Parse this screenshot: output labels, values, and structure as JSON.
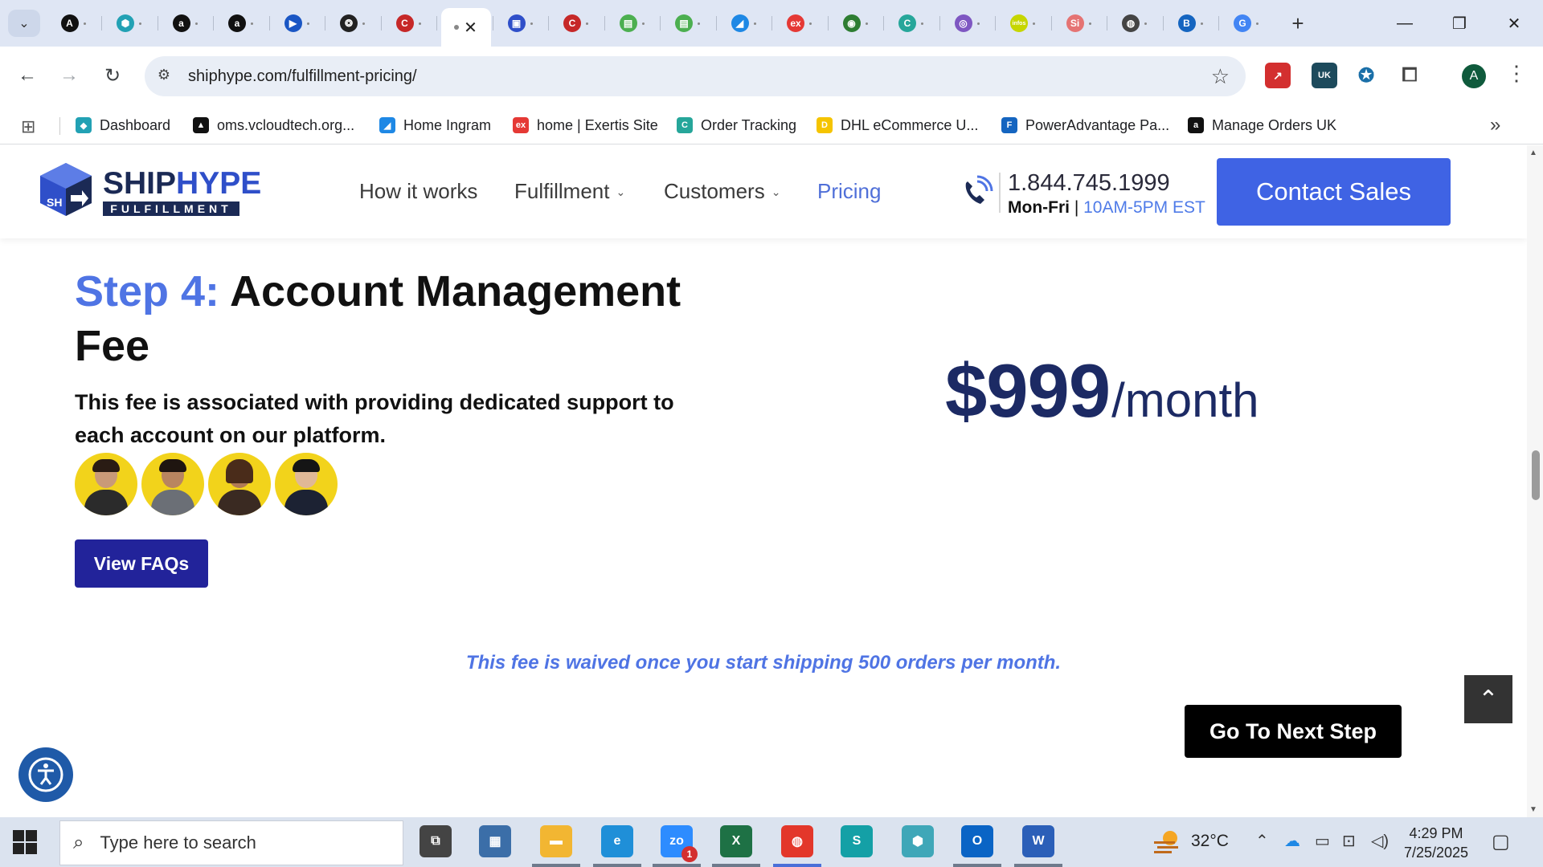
{
  "browser": {
    "tabs": [
      {
        "icon": "a-circle-icon",
        "color": "#111111",
        "glyph": "A"
      },
      {
        "icon": "hex-icon",
        "color": "#22a1b4",
        "glyph": "⬢"
      },
      {
        "icon": "amazon-icon",
        "color": "#111111",
        "glyph": "a"
      },
      {
        "icon": "amazon-icon",
        "color": "#111111",
        "glyph": "a"
      },
      {
        "icon": "play-icon",
        "color": "#1a56c4",
        "glyph": "▶"
      },
      {
        "icon": "chatgpt-icon",
        "color": "#222222",
        "glyph": "❂"
      },
      {
        "icon": "c-icon",
        "color": "#c62828",
        "glyph": "C"
      },
      {
        "icon": "active-tab-icon",
        "color": "#888888",
        "glyph": ""
      },
      {
        "icon": "cube-icon",
        "color": "#2f4fc9",
        "glyph": "▣"
      },
      {
        "icon": "c-icon",
        "color": "#c62828",
        "glyph": "C"
      },
      {
        "icon": "sheet-icon",
        "color": "#4caf50",
        "glyph": "▤"
      },
      {
        "icon": "sheet-icon",
        "color": "#4caf50",
        "glyph": "▤"
      },
      {
        "icon": "ingram-icon",
        "color": "#1e88e5",
        "glyph": "◢"
      },
      {
        "icon": "exertis-icon",
        "color": "#e53935",
        "glyph": "ex"
      },
      {
        "icon": "leaf-icon",
        "color": "#2e7d32",
        "glyph": "◉"
      },
      {
        "icon": "ctrack-icon",
        "color": "#26a69a",
        "glyph": "C"
      },
      {
        "icon": "chart-icon",
        "color": "#7e57c2",
        "glyph": "◎"
      },
      {
        "icon": "infos-icon",
        "color": "#c6d600",
        "glyph": "infos"
      },
      {
        "icon": "silver-icon",
        "color": "#e57373",
        "glyph": "Si"
      },
      {
        "icon": "chrome-icon",
        "color": "#444444",
        "glyph": "◍"
      },
      {
        "icon": "bold-b-icon",
        "color": "#1565c0",
        "glyph": "B"
      },
      {
        "icon": "google-icon",
        "color": "#4285f4",
        "glyph": "G"
      }
    ],
    "url": "shiphype.com/fulfillment-pricing/",
    "profile_initial": "A",
    "bookmarks": [
      {
        "label": "Dashboard",
        "color": "#22a1b4",
        "glyph": "◆"
      },
      {
        "label": "oms.vcloudtech.org...",
        "color": "#111111",
        "glyph": "▲"
      },
      {
        "label": "Home Ingram",
        "color": "#1e88e5",
        "glyph": "◢"
      },
      {
        "label": "home | Exertis Site",
        "color": "#e53935",
        "glyph": "ex"
      },
      {
        "label": "Order Tracking",
        "color": "#26a69a",
        "glyph": "C"
      },
      {
        "label": "DHL eCommerce U...",
        "color": "#f5c400",
        "glyph": "D"
      },
      {
        "label": "PowerAdvantage Pa...",
        "color": "#1565c0",
        "glyph": "F"
      },
      {
        "label": "Manage Orders UK",
        "color": "#111111",
        "glyph": "a"
      }
    ]
  },
  "site": {
    "logo": {
      "name_part1": "SHIP",
      "name_part2": "HYPE",
      "sub": "FULFILLMENT",
      "cube_initials": "SH"
    },
    "nav": [
      {
        "label": "How it works",
        "has_dropdown": false,
        "active": false
      },
      {
        "label": "Fulfillment",
        "has_dropdown": true,
        "active": false
      },
      {
        "label": "Customers",
        "has_dropdown": true,
        "active": false
      },
      {
        "label": "Pricing",
        "has_dropdown": false,
        "active": true
      }
    ],
    "dropdown_glyph": "⌄",
    "phone": {
      "number": "1.844.745.1999",
      "days": "Mon-Fri",
      "separator": " | ",
      "hours": "10AM-5PM EST"
    },
    "contact_label": "Contact Sales",
    "colors": {
      "primary": "#3f63e4",
      "accent": "#4f74e4",
      "navy": "#1c2a64",
      "faq": "#22239a",
      "avatar_bg": "#f2d31b"
    }
  },
  "content": {
    "step_label": "Step 4:",
    "step_title": "Account Management Fee",
    "description": "This fee is associated with providing dedicated support to each account on our platform.",
    "team_count": 4,
    "faq_label": "View FAQs",
    "price_amount": "$999",
    "price_period": "/month",
    "waiver": "This fee is waived once you start shipping 500 orders per month.",
    "next_label": "Go To Next Step"
  },
  "taskbar": {
    "search_placeholder": "Type here to search",
    "apps": [
      {
        "name": "task-view",
        "color": "#444444",
        "glyph": "⧉"
      },
      {
        "name": "calculator",
        "color": "#3b6ea8",
        "glyph": "▦"
      },
      {
        "name": "file-explorer",
        "color": "#f2b632",
        "glyph": "▬"
      },
      {
        "name": "edge",
        "color": "#1f8fd8",
        "glyph": "e"
      },
      {
        "name": "zoom",
        "color": "#2d8cff",
        "glyph": "zo"
      },
      {
        "name": "excel",
        "color": "#1e7145",
        "glyph": "X"
      },
      {
        "name": "chrome",
        "color": "#e3372a",
        "glyph": "◍"
      },
      {
        "name": "s-app",
        "color": "#14a0a6",
        "glyph": "S"
      },
      {
        "name": "hex-app",
        "color": "#3fa7b8",
        "glyph": "⬢"
      },
      {
        "name": "outlook",
        "color": "#0a64c5",
        "glyph": "O"
      },
      {
        "name": "word",
        "color": "#2b5fb8",
        "glyph": "W"
      }
    ],
    "zoom_badge": "1",
    "temperature": "32°C",
    "time": "4:29 PM",
    "date": "7/25/2025"
  }
}
